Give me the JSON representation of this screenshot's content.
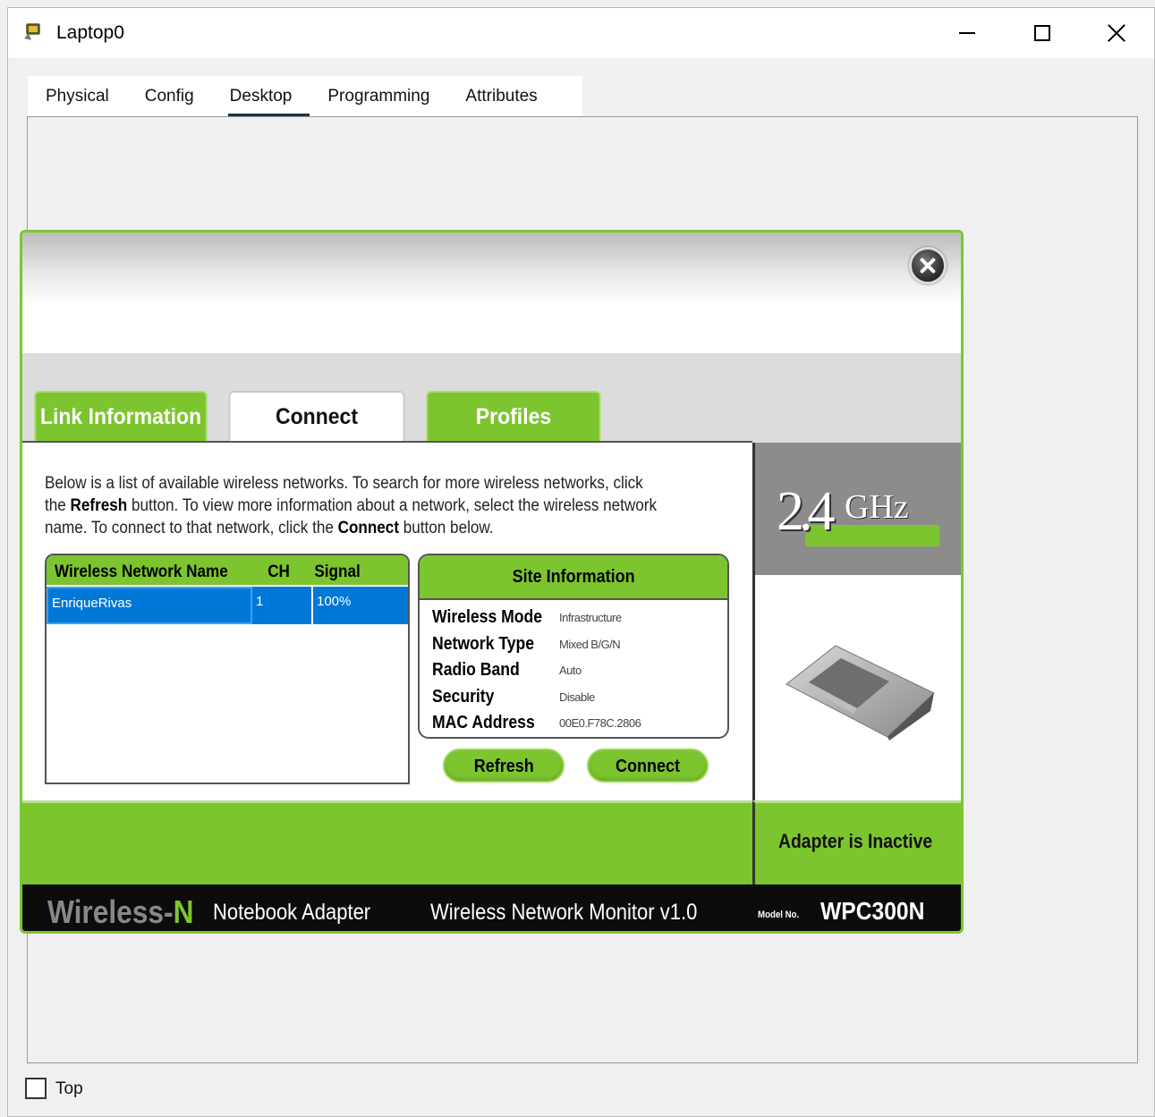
{
  "window": {
    "title": "Laptop0",
    "tabs": [
      "Physical",
      "Config",
      "Desktop",
      "Programming",
      "Attributes"
    ],
    "active_tab": "Desktop"
  },
  "app": {
    "tabs": {
      "link_information": "Link Information",
      "connect": "Connect",
      "profiles": "Profiles"
    },
    "description": {
      "l1": "Below is a list of available wireless networks. To search for more wireless networks, click",
      "l2a": "the ",
      "l2b": "Refresh",
      "l2c": " button. To view more information about a network, select the wireless network",
      "l3a": "name. To connect to that network, click the ",
      "l3b": "Connect",
      "l3c": " button below."
    },
    "network_table": {
      "headers": {
        "name": "Wireless Network Name",
        "ch": "CH",
        "signal": "Signal"
      },
      "rows": [
        {
          "name": "EnriqueRivas",
          "ch": "1",
          "signal": "100%"
        }
      ]
    },
    "site_info": {
      "title": "Site Information",
      "rows": [
        {
          "label": "Wireless Mode",
          "value": "Infrastructure"
        },
        {
          "label": "Network Type",
          "value": "Mixed B/G/N"
        },
        {
          "label": "Radio Band",
          "value": "Auto"
        },
        {
          "label": "Security",
          "value": "Disable"
        },
        {
          "label": "MAC Address",
          "value": "00E0.F78C.2806"
        }
      ]
    },
    "buttons": {
      "refresh": "Refresh",
      "connect": "Connect"
    },
    "band": {
      "number": "2.4",
      "unit": "GHz"
    },
    "status": "Adapter is Inactive",
    "footer": {
      "brand": "Wireless-",
      "brand_n": "N",
      "adapter": "Notebook Adapter",
      "monitor": "Wireless Network Monitor  v1.0",
      "model_label": "Model No.",
      "model": "WPC300N"
    }
  },
  "bottom": {
    "top_label": "Top",
    "top_checked": false
  },
  "colors": {
    "accent_green": "#7cc52e",
    "selection_blue": "#0078d7",
    "footer_black": "#0c0c0c"
  }
}
